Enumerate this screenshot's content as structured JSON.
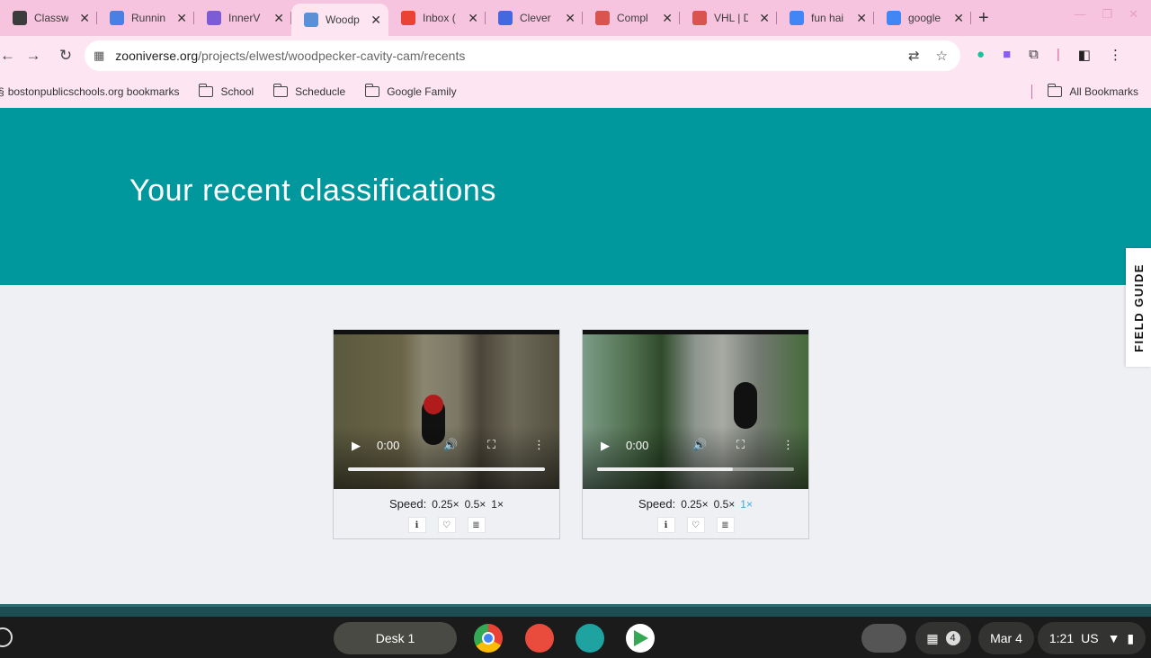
{
  "browser": {
    "tabs": [
      {
        "title": "Classw",
        "favicon_color": "#3c3c3c"
      },
      {
        "title": "Runnin",
        "favicon_color": "#4a7fe4"
      },
      {
        "title": "InnerV",
        "favicon_color": "#7b5cd6"
      },
      {
        "title": "Woodp",
        "favicon_color": "#5b8fd6",
        "active": true
      },
      {
        "title": "Inbox (",
        "favicon_color": "#ea4335"
      },
      {
        "title": "Clever",
        "favicon_color": "#4368e0"
      },
      {
        "title": "Compl",
        "favicon_color": "#d9534f"
      },
      {
        "title": "VHL | D",
        "favicon_color": "#d9534f"
      },
      {
        "title": "fun hai",
        "favicon_color": "#4285f4"
      },
      {
        "title": "google",
        "favicon_color": "#4285f4"
      }
    ],
    "url_host": "zooniverse.org",
    "url_path": "/projects/elwest/woodpecker-cavity-cam/recents",
    "bookmarks": [
      {
        "label": "bostonpublicschools.org bookmarks"
      },
      {
        "label": "School"
      },
      {
        "label": "Scheducle"
      },
      {
        "label": "Google Family"
      }
    ],
    "all_bookmarks_label": "All Bookmarks"
  },
  "page": {
    "heading": "Your recent classifications",
    "field_guide_label": "FIELD GUIDE",
    "cards": [
      {
        "time": "0:00",
        "speed_label": "Speed:",
        "speeds": [
          "0.25×",
          "0.5×",
          "1×"
        ],
        "selected_speed_index": -1,
        "progress": 0.0
      },
      {
        "time": "0:00",
        "speed_label": "Speed:",
        "speeds": [
          "0.25×",
          "0.5×",
          "1×"
        ],
        "selected_speed_index": 2,
        "progress": 0.0
      }
    ]
  },
  "shelf": {
    "desk_label": "Desk 1",
    "notification_count": "4",
    "date": "Mar 4",
    "time": "1:21",
    "locale": "US"
  }
}
